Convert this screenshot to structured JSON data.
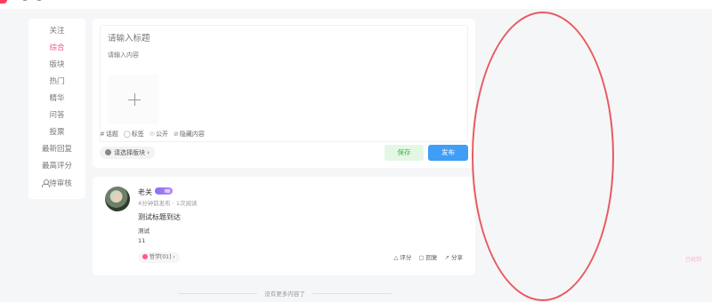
{
  "colors": {
    "accent": "#ff4f7e",
    "publish": "#3f9ef7",
    "save_text": "#3bb34a",
    "annotation": "#e85a5f"
  },
  "sidebar": {
    "items": [
      {
        "label": "关注",
        "active": false
      },
      {
        "label": "综合",
        "active": true
      },
      {
        "label": "版块",
        "active": false
      },
      {
        "label": "热门",
        "active": false
      },
      {
        "label": "精华",
        "active": false
      },
      {
        "label": "问答",
        "active": false
      },
      {
        "label": "投票",
        "active": false
      },
      {
        "label": "最新回复",
        "active": false
      },
      {
        "label": "最高评分",
        "active": false
      },
      {
        "label": "待审核",
        "active": false,
        "icon": "person-icon"
      }
    ]
  },
  "editor": {
    "title_placeholder": "请输入标题",
    "content_placeholder": "请输入内容",
    "upload_icon": "plus-icon",
    "tools": [
      {
        "icon": "hash-icon",
        "label": "话题"
      },
      {
        "icon": "tag-icon",
        "label": "标签"
      },
      {
        "icon": "eye-icon",
        "label": "公开"
      },
      {
        "icon": "hidden-icon",
        "label": "隐藏内容"
      }
    ],
    "board_select": "请选择版块 ›",
    "save_label": "保存",
    "publish_label": "发布"
  },
  "post": {
    "author": "老关",
    "meta": "4分钟前发布 · 1次阅读",
    "title": "测试标题到达",
    "body_line1": "测试",
    "body_line2": "11",
    "tag": "哲学[01] ›",
    "actions": {
      "rate": "评分",
      "reply": "回复",
      "share": "分享"
    }
  },
  "footer": {
    "no_more": "没有更多内容了"
  },
  "right_hint": "已经到"
}
